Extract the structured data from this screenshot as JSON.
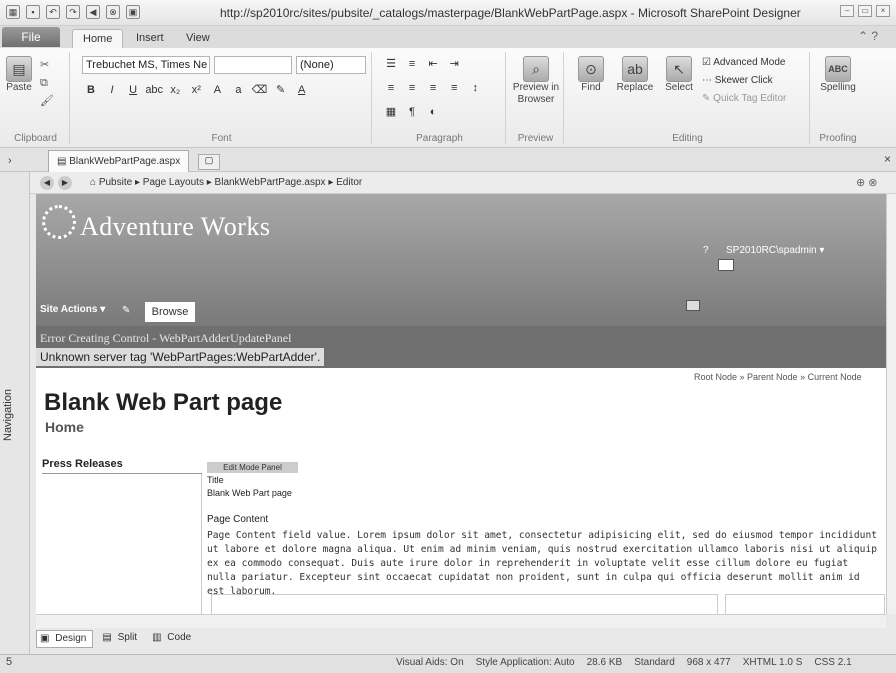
{
  "window": {
    "title": "http://sp2010rc/sites/pubsite/_catalogs/masterpage/BlankWebPartPage.aspx - Microsoft SharePoint Designer"
  },
  "ribbon": {
    "tabs": [
      {
        "label": "File"
      },
      {
        "label": "Home"
      },
      {
        "label": "Insert"
      },
      {
        "label": "View"
      }
    ],
    "groups": {
      "clipboard": "Clipboard",
      "font": "Font",
      "paragraph": "Paragraph",
      "preview": "Preview",
      "editing": "Editing",
      "proofing": "Proofing"
    },
    "paste_label": "Paste",
    "font_name": "Trebuchet MS, Times Ne",
    "font_size": "",
    "style_value": "(None)",
    "preview_label": "Preview in Browser",
    "find_label": "Find",
    "replace_label": "Replace",
    "select_label": "Select",
    "advanced_mode": "Advanced Mode",
    "skewer_click": "Skewer Click",
    "quick_tag_editor": "Quick Tag Editor",
    "spelling_label": "Spelling"
  },
  "doc": {
    "tab_label": "BlankWebPartPage.aspx",
    "breadcrumb": [
      "Pubsite",
      "Page Layouts",
      "BlankWebPartPage.aspx",
      "Editor"
    ]
  },
  "navigation_label": "Navigation",
  "page": {
    "logo": "Adventure Works",
    "user": "SP2010RC\\spadmin",
    "help": "?",
    "site_actions": "Site Actions",
    "browse_tab": "Browse",
    "error_title": "Error Creating Control - WebPartAdderUpdatePanel",
    "error_msg": "Unknown server tag 'WebPartPages:WebPartAdder'.",
    "crumb": "Root Node » Parent Node » Current Node",
    "title": "Blank Web Part page",
    "subtitle": "Home",
    "press_releases": "Press Releases",
    "edit_mode_panel": "Edit Mode Panel",
    "field_title": "Title",
    "field_title_value": "Blank Web Part page",
    "content_heading": "Page Content",
    "content_body": "Page Content field value. Lorem ipsum dolor sit amet, consectetur adipisicing elit, sed do eiusmod tempor incididunt ut labore et dolore magna aliqua. Ut enim ad minim veniam, quis nostrud exercitation ullamco laboris nisi ut aliquip ex ea commodo consequat. Duis aute irure dolor in reprehenderit in voluptate velit esse cillum dolore eu fugiat nulla pariatur. Excepteur sint occaecat cupidatat non proident, sunt in culpa qui officia deserunt mollit anim id est laborum."
  },
  "views": {
    "design": "Design",
    "split": "Split",
    "code": "Code"
  },
  "status": {
    "left": "5",
    "visual_aids": "Visual Aids: On",
    "style_app": "Style Application: Auto",
    "size": "28.6 KB",
    "mode": "Standard",
    "dims": "968 x 477",
    "doctype": "XHTML 1.0 S",
    "css": "CSS 2.1"
  }
}
